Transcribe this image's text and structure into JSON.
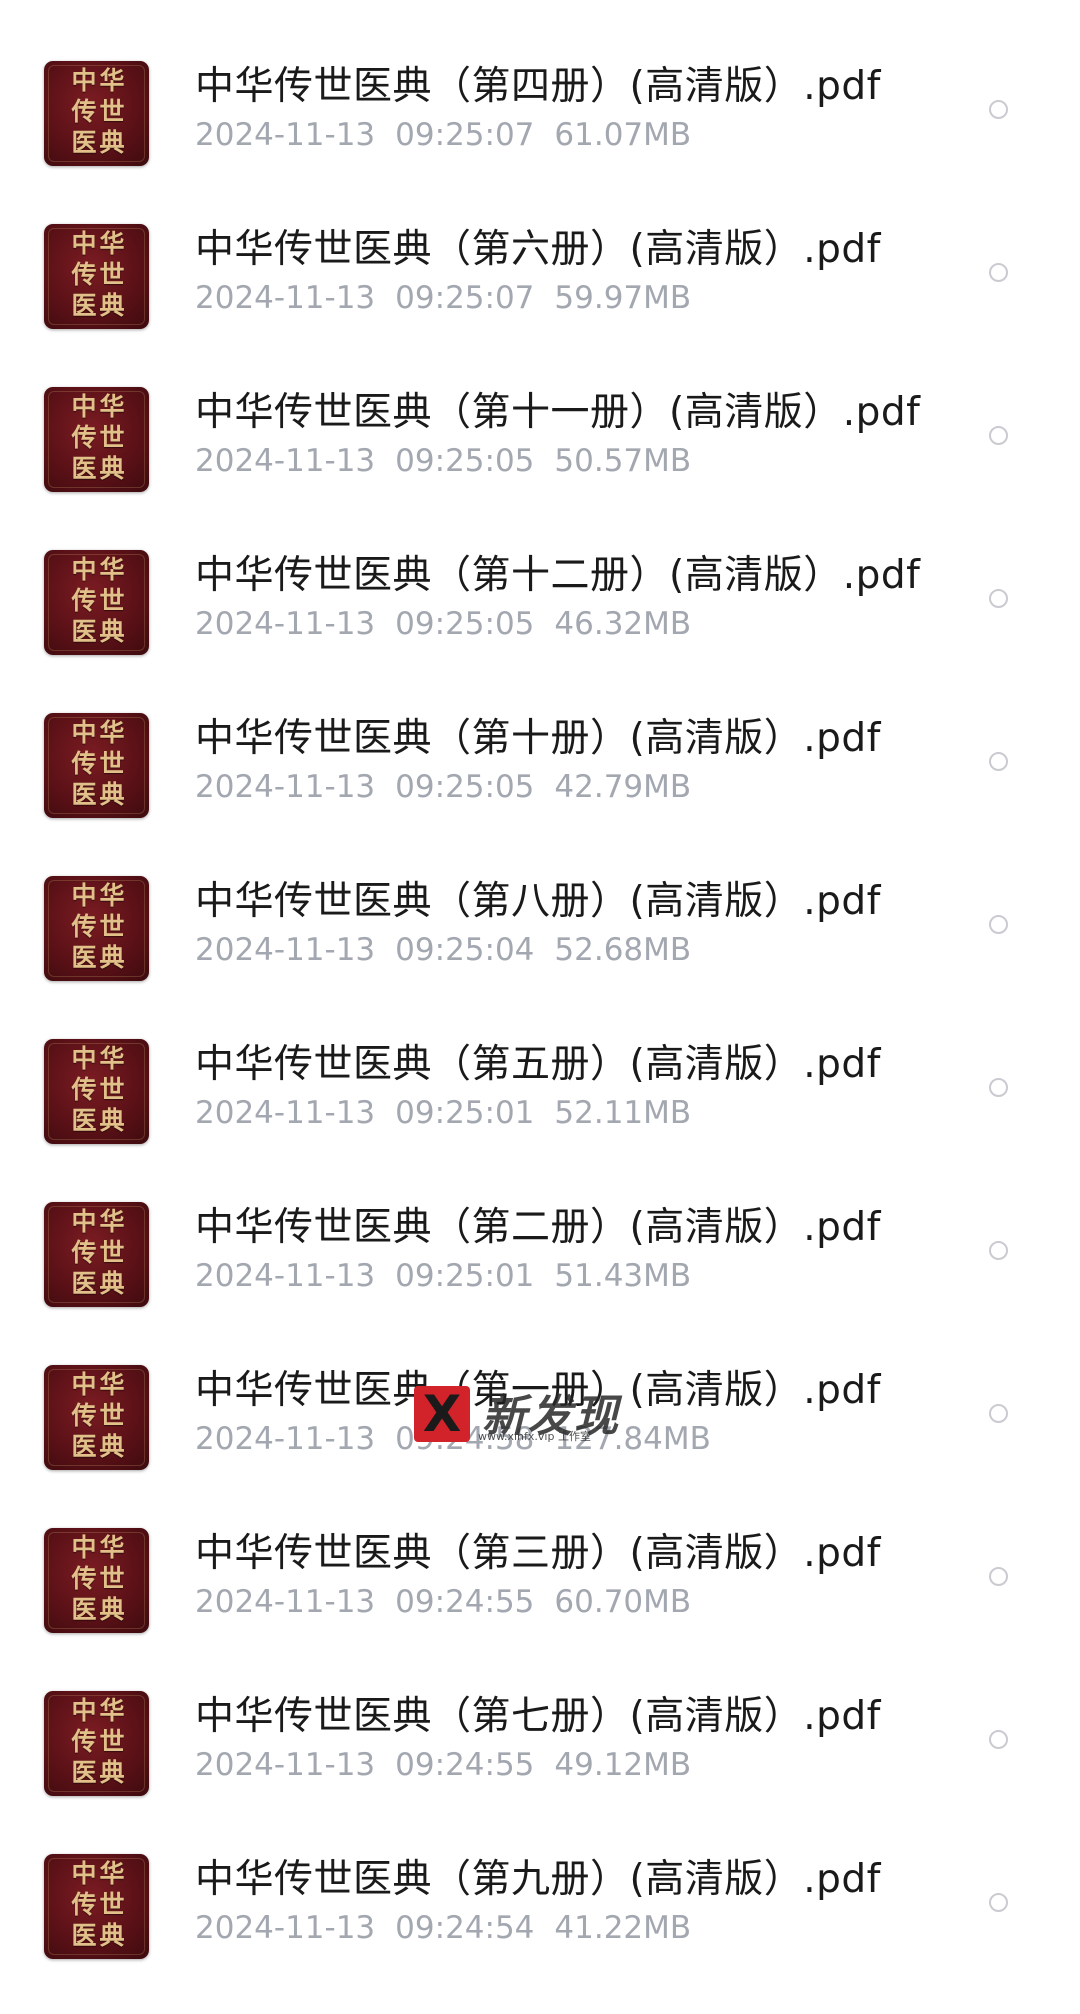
{
  "thumbnail": {
    "glyphs": [
      "中",
      "华",
      "传",
      "世",
      "医",
      "典"
    ],
    "colors": {
      "cover": "#5b1117",
      "lettering": "#e2c089"
    }
  },
  "colors": {
    "name_text": "#1a1a1a",
    "meta_text": "#a3a7b0",
    "radio_border": "#c9cbd0",
    "watermark_red": "#d2232a"
  },
  "files": [
    {
      "name": "中华传世医典（第四册）(高清版）.pdf",
      "date": "2024-11-13",
      "time": "09:25:07",
      "size": "61.07MB"
    },
    {
      "name": "中华传世医典（第六册）(高清版）.pdf",
      "date": "2024-11-13",
      "time": "09:25:07",
      "size": "59.97MB"
    },
    {
      "name": "中华传世医典（第十一册）(高清版）.pdf",
      "date": "2024-11-13",
      "time": "09:25:05",
      "size": "50.57MB"
    },
    {
      "name": "中华传世医典（第十二册）(高清版）.pdf",
      "date": "2024-11-13",
      "time": "09:25:05",
      "size": "46.32MB"
    },
    {
      "name": "中华传世医典（第十册）(高清版）.pdf",
      "date": "2024-11-13",
      "time": "09:25:05",
      "size": "42.79MB"
    },
    {
      "name": "中华传世医典（第八册）(高清版）.pdf",
      "date": "2024-11-13",
      "time": "09:25:04",
      "size": "52.68MB"
    },
    {
      "name": "中华传世医典（第五册）(高清版）.pdf",
      "date": "2024-11-13",
      "time": "09:25:01",
      "size": "52.11MB"
    },
    {
      "name": "中华传世医典（第二册）(高清版）.pdf",
      "date": "2024-11-13",
      "time": "09:25:01",
      "size": "51.43MB"
    },
    {
      "name": "中华传世医典（第一册）(高清版）.pdf",
      "date": "2024-11-13",
      "time": "09:24:58",
      "size": "127.84MB"
    },
    {
      "name": "中华传世医典（第三册）(高清版）.pdf",
      "date": "2024-11-13",
      "time": "09:24:55",
      "size": "60.70MB"
    },
    {
      "name": "中华传世医典（第七册）(高清版）.pdf",
      "date": "2024-11-13",
      "time": "09:24:55",
      "size": "49.12MB"
    },
    {
      "name": "中华传世医典（第九册）(高清版）.pdf",
      "date": "2024-11-13",
      "time": "09:24:54",
      "size": "41.22MB"
    }
  ],
  "watermark": {
    "mark": "X",
    "text": "新发现",
    "url": "www.xinfx.vip 工作室"
  }
}
